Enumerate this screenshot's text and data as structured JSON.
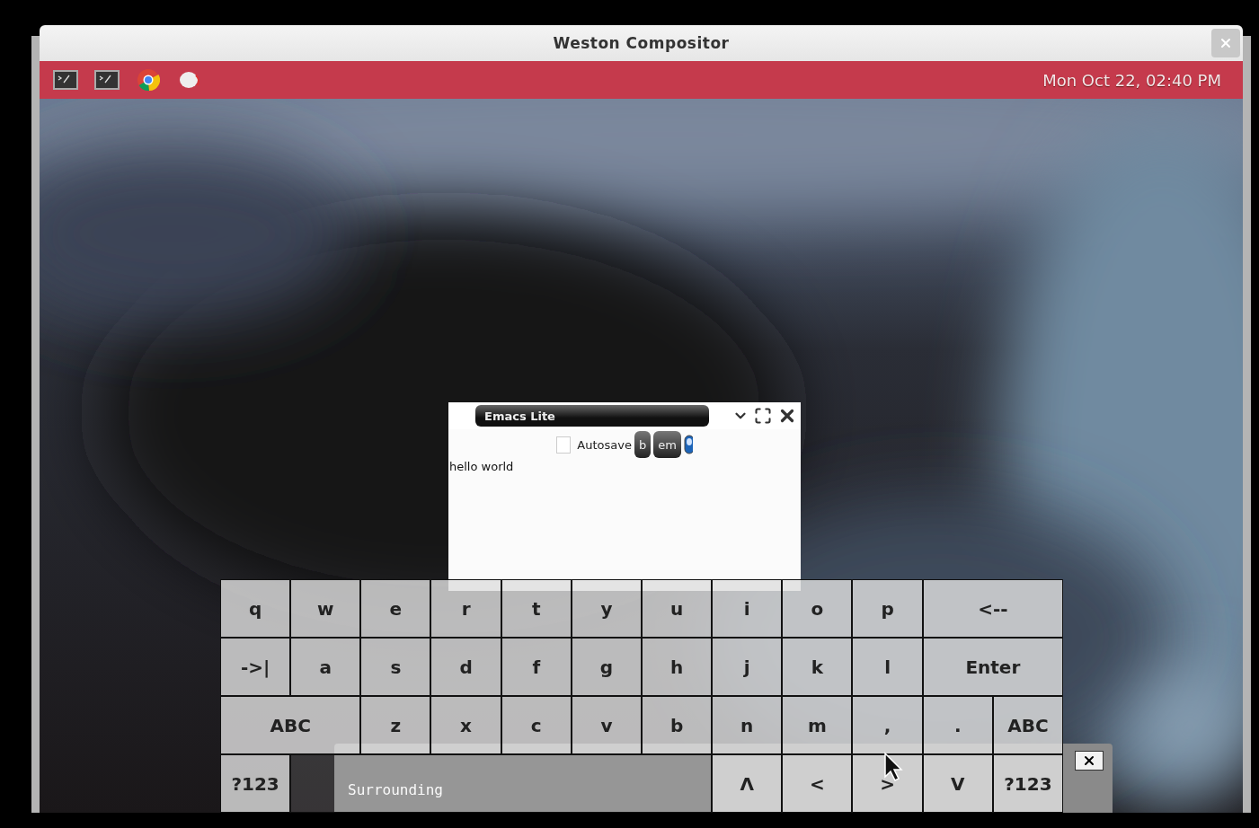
{
  "window": {
    "title": "Weston Compositor"
  },
  "panel": {
    "launchers": [
      {
        "kind": "terminal"
      },
      {
        "kind": "terminal"
      },
      {
        "kind": "browser"
      },
      {
        "kind": "flower"
      }
    ],
    "clock": "Mon Oct 22, 02:40 PM"
  },
  "editor": {
    "title": "Emacs Lite",
    "autosave": {
      "label": "Autosave",
      "checked": false
    },
    "buttons": [
      "b",
      "em"
    ],
    "text": "hello world"
  },
  "background_window": {
    "text": "Surrounding"
  },
  "keyboard": {
    "rows": [
      {
        "keys": [
          {
            "kind": "char",
            "label": "q"
          },
          {
            "kind": "char",
            "label": "w"
          },
          {
            "kind": "char",
            "label": "e"
          },
          {
            "kind": "char",
            "label": "r"
          },
          {
            "kind": "char",
            "label": "t"
          },
          {
            "kind": "char",
            "label": "y"
          },
          {
            "kind": "char",
            "label": "u"
          },
          {
            "kind": "char",
            "label": "i"
          },
          {
            "kind": "char",
            "label": "o"
          },
          {
            "kind": "char",
            "label": "p"
          },
          {
            "kind": "backspace",
            "label": "<--"
          }
        ]
      },
      {
        "keys": [
          {
            "kind": "tab",
            "label": "->|"
          },
          {
            "kind": "char",
            "label": "a"
          },
          {
            "kind": "char",
            "label": "s"
          },
          {
            "kind": "char",
            "label": "d"
          },
          {
            "kind": "char",
            "label": "f"
          },
          {
            "kind": "char",
            "label": "g"
          },
          {
            "kind": "char",
            "label": "h"
          },
          {
            "kind": "char",
            "label": "j"
          },
          {
            "kind": "char",
            "label": "k"
          },
          {
            "kind": "char",
            "label": "l"
          },
          {
            "kind": "enter",
            "label": "Enter"
          }
        ]
      },
      {
        "keys": [
          {
            "kind": "shift",
            "label": "ABC"
          },
          {
            "kind": "char",
            "label": "z"
          },
          {
            "kind": "char",
            "label": "x"
          },
          {
            "kind": "char",
            "label": "c"
          },
          {
            "kind": "char",
            "label": "v"
          },
          {
            "kind": "char",
            "label": "b"
          },
          {
            "kind": "char",
            "label": "n"
          },
          {
            "kind": "char",
            "label": "m"
          },
          {
            "kind": "char",
            "label": ","
          },
          {
            "kind": "char",
            "label": "."
          },
          {
            "kind": "switch",
            "label": "ABC"
          }
        ]
      },
      {
        "keys": [
          {
            "kind": "symbols",
            "label": "?123"
          },
          {
            "kind": "space"
          },
          {
            "kind": "arrow",
            "label": "Λ"
          },
          {
            "kind": "arrow",
            "label": "<"
          },
          {
            "kind": "arrow",
            "label": ">"
          },
          {
            "kind": "arrow",
            "label": "V"
          },
          {
            "kind": "symbols",
            "label": "?123"
          }
        ]
      }
    ]
  }
}
